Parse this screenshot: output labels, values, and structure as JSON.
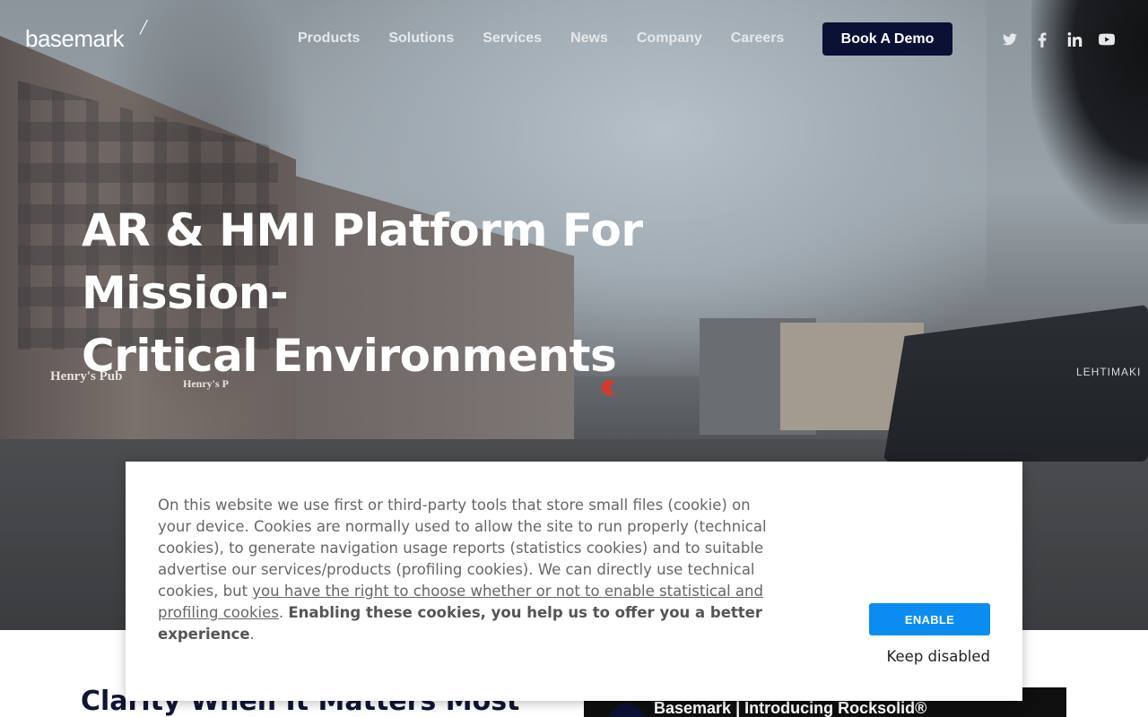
{
  "brand": {
    "logo_text": "basemark"
  },
  "nav": {
    "items": [
      "Products",
      "Solutions",
      "Services",
      "News",
      "Company",
      "Careers"
    ],
    "cta_label": "Book A Demo"
  },
  "social": {
    "twitter": "twitter-icon",
    "facebook": "facebook-icon",
    "linkedin": "linkedin-icon",
    "youtube": "youtube-icon"
  },
  "hero": {
    "title_line1": "AR & HMI Platform For Mission-",
    "title_line2": "Critical Environments",
    "scene_signs": [
      "Henry's Pub",
      "Henry's P",
      "LEHTIMAKI"
    ]
  },
  "section": {
    "title": "Clarity When It Matters Most",
    "video_title": "Basemark | Introducing Rocksolid®",
    "video_channel_mark": "b'"
  },
  "cookie": {
    "text_plain": "On this website we use first or third-party tools that store small files (cookie) on your device. Cookies are normally used to allow the site to run properly (technical cookies), to generate navigation usage reports (statistics cookies) and to suitable advertise our services/products (profiling cookies). We can directly use technical cookies, but ",
    "text_link": "you have the right to choose whether or not to enable statistical and profiling cookies",
    "text_after_link": ". ",
    "text_strong": "Enabling these cookies, you help us to offer you a better experience",
    "text_end": ".",
    "enable_label": "ENABLE",
    "keep_label": "Keep disabled"
  },
  "colors": {
    "cta_bg": "#0b1035",
    "enable_bg": "#0a8cf0",
    "heading_dark": "#101535"
  }
}
